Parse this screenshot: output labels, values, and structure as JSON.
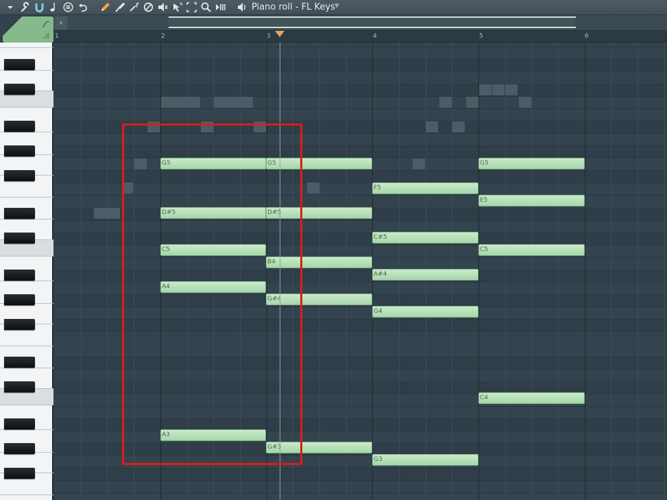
{
  "toolbar": {
    "title": "Piano roll - FL Keys",
    "icons": [
      "menu-arrow-icon",
      "wrench-icon",
      "magnet-icon",
      "note-icon",
      "stamp-icon",
      "undo-icon",
      "pencil-icon",
      "brush-icon",
      "delete-icon",
      "mute-icon",
      "slice-icon",
      "select-icon",
      "zoom-icon",
      "playback-icon",
      "speaker-icon"
    ]
  },
  "ruler": {
    "bars": [
      "1",
      "2",
      "3",
      "4",
      "5",
      "6"
    ]
  },
  "notes": [
    {
      "label": "G5"
    },
    {
      "label": "G5"
    },
    {
      "label": "G5"
    },
    {
      "label": "F5"
    },
    {
      "label": "E5"
    },
    {
      "label": "D#5"
    },
    {
      "label": "D#5"
    },
    {
      "label": "C#5"
    },
    {
      "label": "C5"
    },
    {
      "label": "C5"
    },
    {
      "label": "B4"
    },
    {
      "label": "A#4"
    },
    {
      "label": "A4"
    },
    {
      "label": "G#4"
    },
    {
      "label": "G4"
    },
    {
      "label": "C4"
    },
    {
      "label": "A3"
    },
    {
      "label": "G#3"
    },
    {
      "label": "G3"
    }
  ],
  "colors": {
    "note": "#a7d6aa",
    "selection": "#e01a1a",
    "playhead_marker": "#f0a060"
  }
}
